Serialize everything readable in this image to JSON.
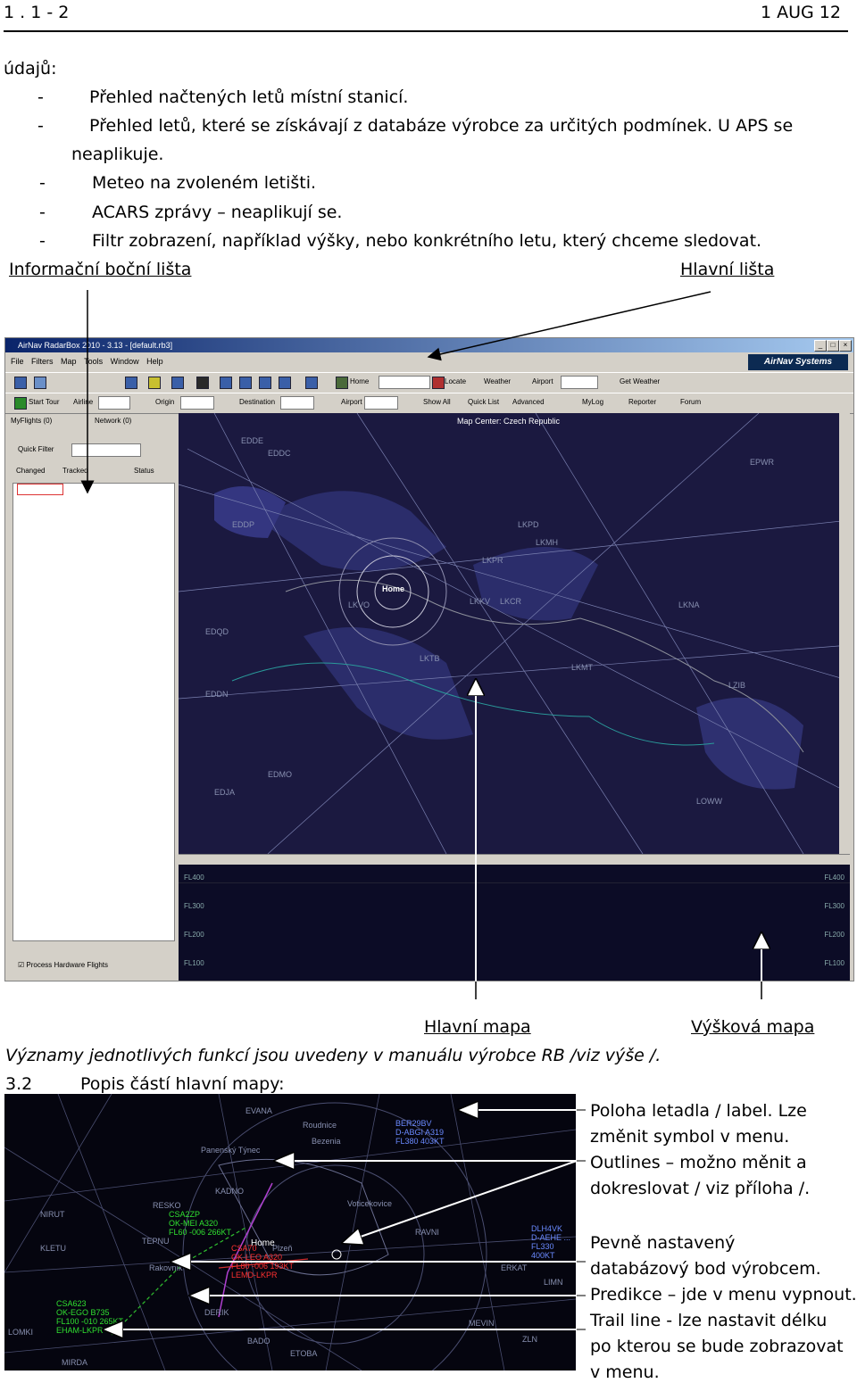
{
  "header": {
    "left": "1 . 1 - 2",
    "right": "1 AUG 12"
  },
  "intro": {
    "lead": "údajů:",
    "bullets": [
      {
        "dash": "-",
        "text": "Přehled načtených letů místní stanicí."
      },
      {
        "dash": "-",
        "text": "Přehled letů, které se získávají z databáze výrobce za určitých podmínek. U APS se"
      },
      {
        "cont": "neaplikuje."
      },
      {
        "dash": "-",
        "text": "Meteo na zvoleném letišti."
      },
      {
        "dash": "-",
        "text": "ACARS zprávy – neaplikují se."
      },
      {
        "dash": "-",
        "text": "Filtr zobrazení, například výšky, nebo  konkrétního letu, který chceme sledovat."
      }
    ]
  },
  "callouts": {
    "side_panel": "Informační boční lišta",
    "main_toolbar": "Hlavní lišta",
    "main_map": "Hlavní mapa",
    "alt_map": "Výšková mapa"
  },
  "screenshot": {
    "title": "AirNav RadarBox 2010 - 3.13 - [default.rb3]",
    "menus": [
      "File",
      "Filters",
      "Map",
      "Tools",
      "Window",
      "Help"
    ],
    "logo": "AirNav Systems",
    "toolbar1": [
      "Home",
      "Locate",
      "Weather",
      "Airport",
      "Get Weather"
    ],
    "toolbar2": [
      "Start Tour",
      "Airline",
      "Origin",
      "Destination",
      "Airport",
      "Show All",
      "Quick List",
      "Advanced",
      "MyLog",
      "Reporter",
      "Forum"
    ],
    "tabs": [
      "MyFlights (0)",
      "Network (0)"
    ],
    "quick_filter": "Quick Filter",
    "columns": [
      "Changed",
      "Tracked",
      "Status"
    ],
    "process_hw": "Process Hardware Flights",
    "map_center": "Map Center: Czech Republic",
    "home": "Home",
    "flight_levels": [
      "FL400",
      "FL300",
      "FL200",
      "FL100"
    ],
    "map_labels": [
      "EDDC",
      "EDDE",
      "LKPR",
      "LKKV",
      "LKCR",
      "LKTB",
      "LZIB",
      "EPWR",
      "EDQD",
      "EDDN",
      "LKMT",
      "EDMO",
      "LOWW",
      "EDJA",
      "EDDP",
      "LKPD",
      "LKVO",
      "LKMH",
      "LKNA"
    ]
  },
  "note": "Významy jednotlivých funkcí jsou uvedeny v manuálu výrobce RB /viz výše /.",
  "section": {
    "num": "3.2",
    "title": "Popis částí hlavní mapy:"
  },
  "map2": {
    "labels": [
      "EVANA",
      "Roudnice",
      "Bezenia",
      "Panenský Týnec",
      "KADNO",
      "Voticekovice",
      "RESKO",
      "TEPNU",
      "Rakovník",
      "Plzeň",
      "RAVNI",
      "DERIK",
      "BADO",
      "ERKAT",
      "LIMN",
      "MEVIN",
      "NIRUT",
      "ZLN",
      "LOMKI",
      "MIRDA",
      "ETOBA",
      "KLETU"
    ],
    "flights": [
      {
        "l1": "BER29BV",
        "l2": "D-ABGI A319",
        "l3": "FL380 403KT"
      },
      {
        "l1": "CSA2ZP",
        "l2": "OK-MEI A320",
        "l3": "FL60 -006 266KT"
      },
      {
        "l1": "CSA70",
        "l2": "OK-LEO A320",
        "l3": "FL80 -006 193KT",
        "l4": "LEMD-LKPR"
      },
      {
        "l1": "DLH4VK",
        "l2": "D-AEHE ...",
        "l3": "FL330 400KT"
      },
      {
        "l1": "CSA623",
        "l2": "OK-EGO B735",
        "l3": "FL100 -010 265KT",
        "l4": "EHAM-LKPR"
      }
    ],
    "home": "Home"
  },
  "right_notes": [
    "Poloha letadla / label. Lze",
    "změnit symbol v menu.",
    "Outlines – možno měnit  a",
    "dokreslovat / viz příloha /.",
    "Pevně nastavený",
    "databázový bod výrobcem.",
    "Predikce – jde v menu vypnout.",
    "Trail line -  lze nastavit délku",
    "po kterou se bude zobrazovat",
    "v menu."
  ]
}
